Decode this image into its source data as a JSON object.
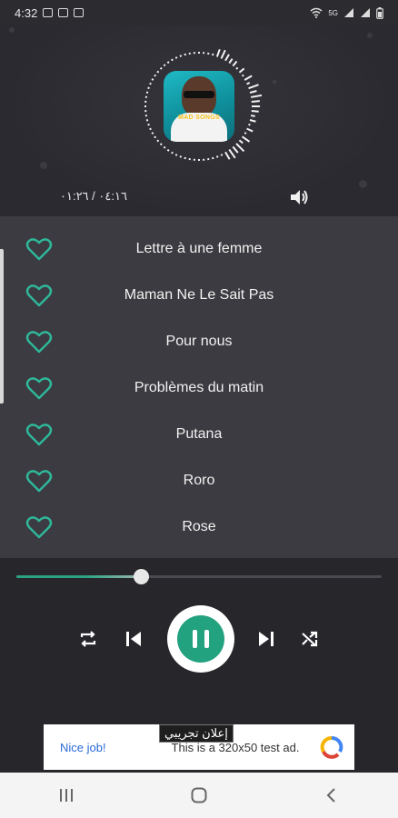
{
  "status_bar": {
    "time": "4:32",
    "network": "5G"
  },
  "player": {
    "album_label": "MAD SONGS",
    "time_readout": "٠٤:١٦ / ٠١:٢٦",
    "progress": 0.34
  },
  "songs": [
    {
      "title": "Lettre à une femme"
    },
    {
      "title": "Maman Ne Le Sait Pas"
    },
    {
      "title": "Pour nous"
    },
    {
      "title": "Problèmes du matin"
    },
    {
      "title": "Putana"
    },
    {
      "title": "Roro"
    },
    {
      "title": "Rose"
    }
  ],
  "ad": {
    "badge": "إعلان تجريبي",
    "nice_job": "Nice job!",
    "text": "This is a 320x50 test ad."
  },
  "colors": {
    "accent": "#23a27f",
    "heart": "#2fb89a",
    "background": "#2b2b30",
    "list_background": "#3b3b41"
  },
  "icons": {
    "volume": "volume-icon",
    "heart": "heart-outline-icon",
    "repeat": "repeat-icon",
    "previous": "skip-previous-icon",
    "pause": "pause-icon",
    "next": "skip-next-icon",
    "shuffle": "shuffle-icon",
    "recents": "recent-apps-icon",
    "home": "home-icon",
    "back": "back-icon"
  }
}
